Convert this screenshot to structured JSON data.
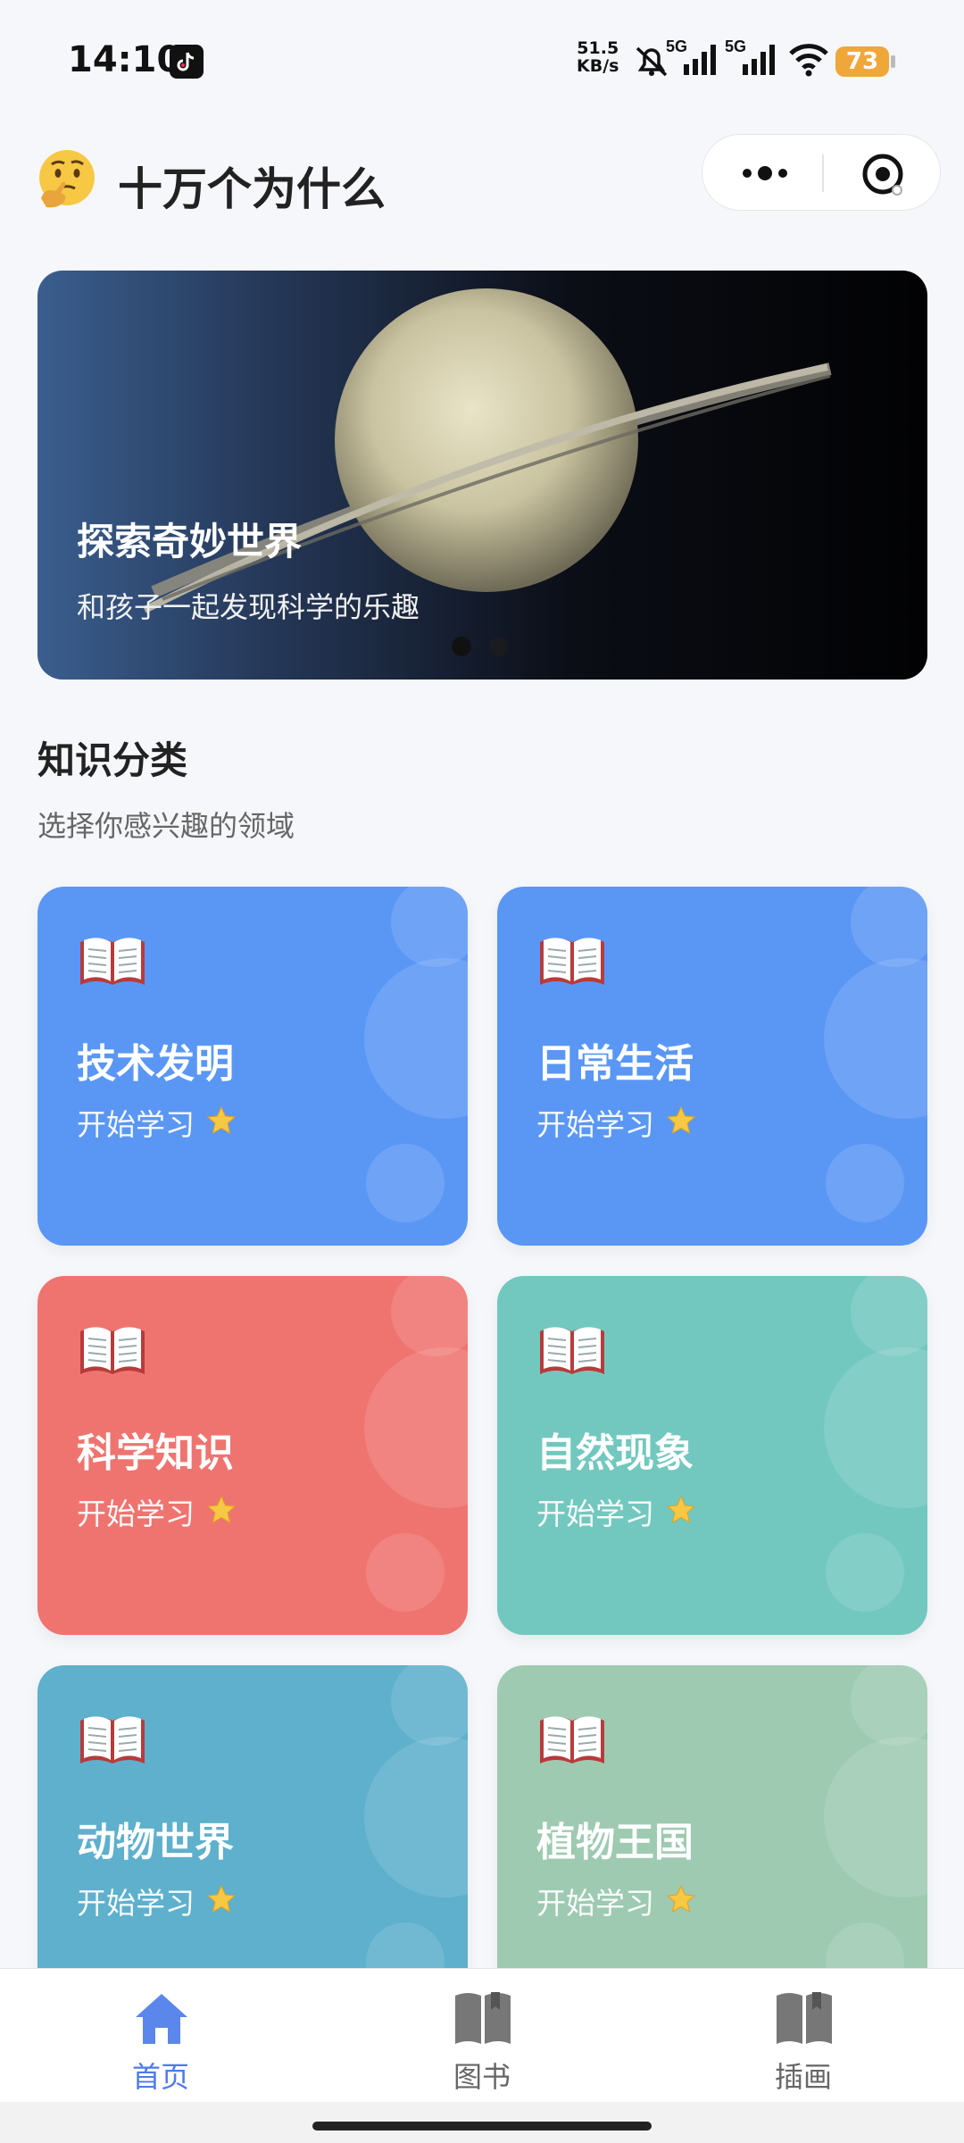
{
  "status_bar": {
    "time": "14:10",
    "net_speed_value": "51.5",
    "net_speed_unit": "KB/s",
    "signal_1": "5G",
    "signal_2": "5G",
    "battery": "73",
    "icons": [
      "tiktok-icon",
      "mute-icon",
      "signal-icon",
      "signal-icon",
      "wifi-icon",
      "battery-icon"
    ]
  },
  "header": {
    "emoji_icon": "thinking-face-icon",
    "title": "十万个为什么"
  },
  "banner": {
    "title": "探索奇妙世界",
    "subtitle": "和孩子一起发现科学的乐趣",
    "slide_count": 2,
    "active_slide": 1
  },
  "section": {
    "title": "知识分类",
    "subtitle": "选择你感兴趣的领域"
  },
  "categories": [
    {
      "title": "技术发明",
      "action": "开始学习",
      "color": "#5a97f5"
    },
    {
      "title": "日常生活",
      "action": "开始学习",
      "color": "#5a97f5"
    },
    {
      "title": "科学知识",
      "action": "开始学习",
      "color": "#ef7470"
    },
    {
      "title": "自然现象",
      "action": "开始学习",
      "color": "#72c8bf"
    },
    {
      "title": "动物世界",
      "action": "开始学习",
      "color": "#5eb0cc"
    },
    {
      "title": "植物王国",
      "action": "开始学习",
      "color": "#9ecab1"
    }
  ],
  "tabs": [
    {
      "label": "首页",
      "icon": "home-icon",
      "active": true
    },
    {
      "label": "图书",
      "icon": "book-icon",
      "active": false
    },
    {
      "label": "插画",
      "icon": "book-icon",
      "active": false
    }
  ],
  "colors": {
    "accent": "#4d7be8",
    "background": "#f6f7fb"
  }
}
